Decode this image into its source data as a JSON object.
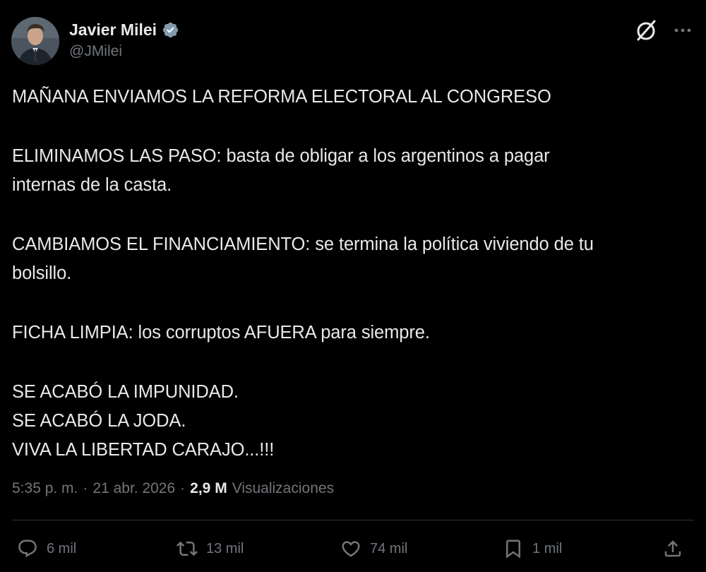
{
  "author": {
    "name": "Javier Milei",
    "handle": "@JMilei",
    "verified_color": "#829aab"
  },
  "icons": {
    "grok": "grok-icon",
    "more": "more-icon",
    "reply": "reply-icon",
    "repost": "repost-icon",
    "like": "like-icon",
    "bookmark": "bookmark-icon",
    "share": "share-icon"
  },
  "tweet": {
    "lines": [
      "MAÑANA ENVIAMOS LA REFORMA ELECTORAL AL CONGRESO",
      "ELIMINAMOS LAS PASO: basta de obligar a los argentinos a pagar",
      "internas de la casta.",
      "CAMBIAMOS EL FINANCIAMIENTO: se termina la política viviendo de tu",
      "bolsillo.",
      "FICHA LIMPIA: los corruptos AFUERA para siempre.",
      "SE ACABÓ LA IMPUNIDAD.",
      "SE ACABÓ LA JODA.",
      "VIVA LA LIBERTAD CARAJO...!!!"
    ]
  },
  "meta": {
    "time": "5:35 p. m.",
    "date": "21 abr. 2026",
    "separator": "·",
    "views_count": "2,9 M",
    "views_label": "Visualizaciones"
  },
  "stats": {
    "replies": "6 mil",
    "reposts": "13 mil",
    "likes": "74 mil",
    "bookmarks": "1 mil"
  },
  "colors": {
    "background": "#000000",
    "text": "#e7e9ea",
    "secondary": "#71767b",
    "divider": "#2f3336"
  }
}
